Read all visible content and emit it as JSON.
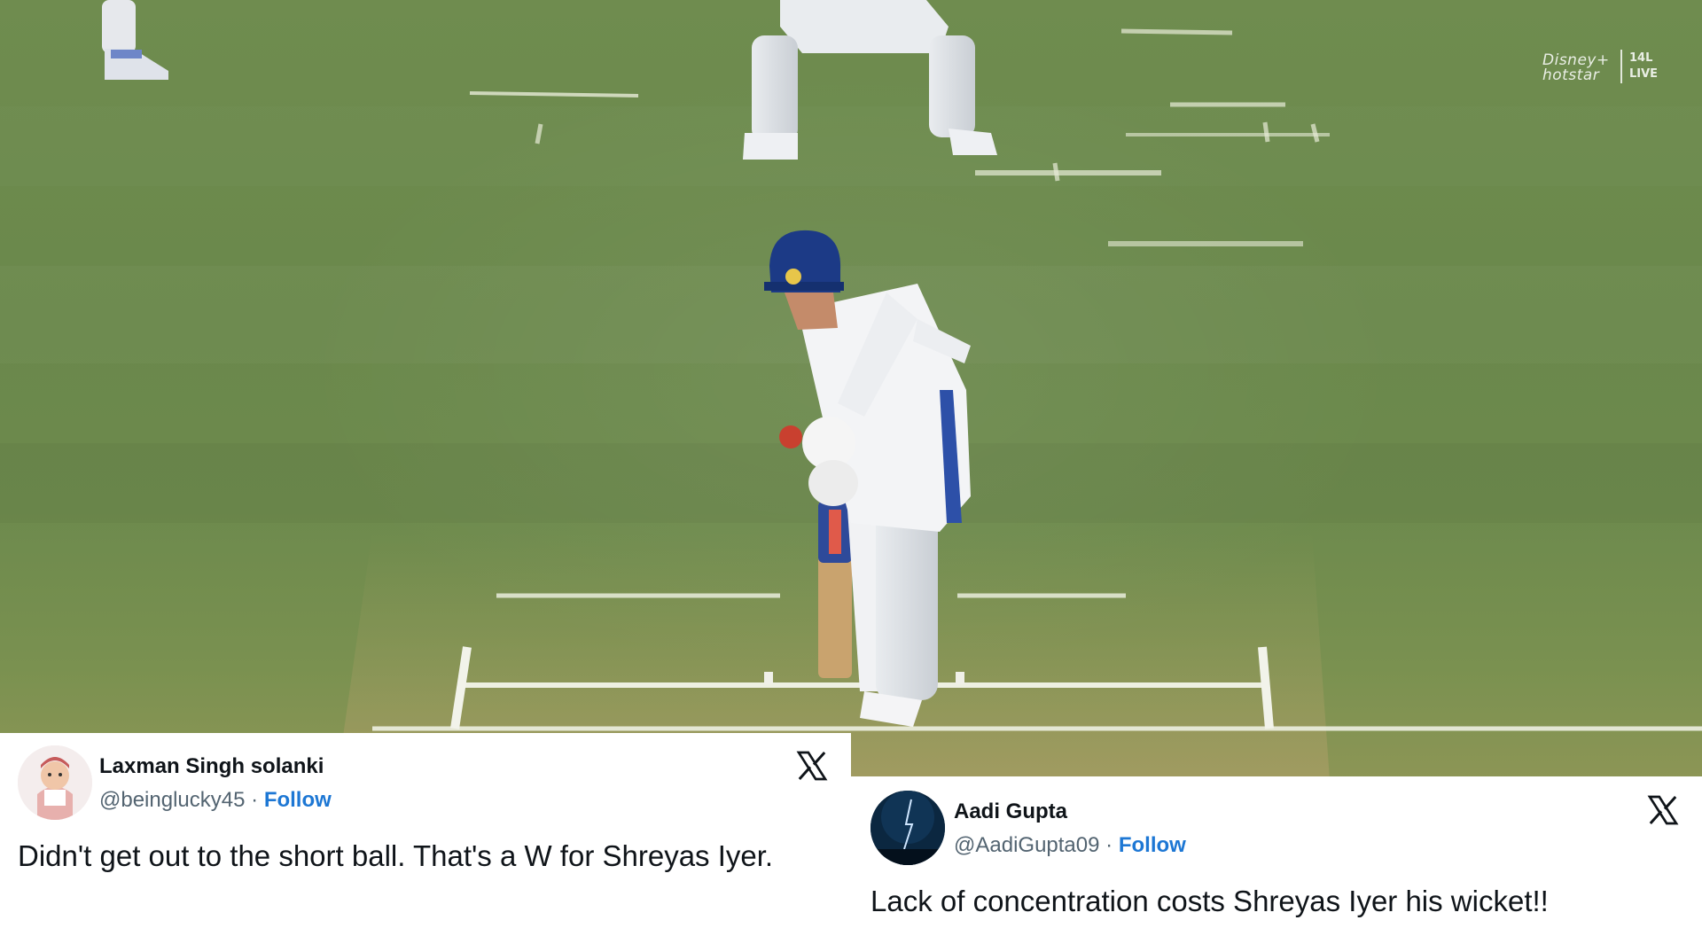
{
  "broadcast": {
    "watermark_brand": "Disney+ hotstar",
    "watermark_count": "14L",
    "watermark_live": "LIVE"
  },
  "tweets": [
    {
      "author_name": "Laxman Singh solanki",
      "handle": "@beinglucky45",
      "separator": "·",
      "follow_label": "Follow",
      "text": "Didn't get out to the short ball. That's a W for Shreyas Iyer.",
      "platform_icon": "x-logo-icon"
    },
    {
      "author_name": "Aadi Gupta",
      "handle": "@AadiGupta09",
      "separator": "·",
      "follow_label": "Follow",
      "text": "Lack of concentration costs Shreyas Iyer his wicket!!",
      "platform_icon": "x-logo-icon"
    }
  ],
  "colors": {
    "pitch_grass": "#6d8a4d",
    "follow_blue": "#1d77d4",
    "tweet_background": "#ffffff"
  }
}
